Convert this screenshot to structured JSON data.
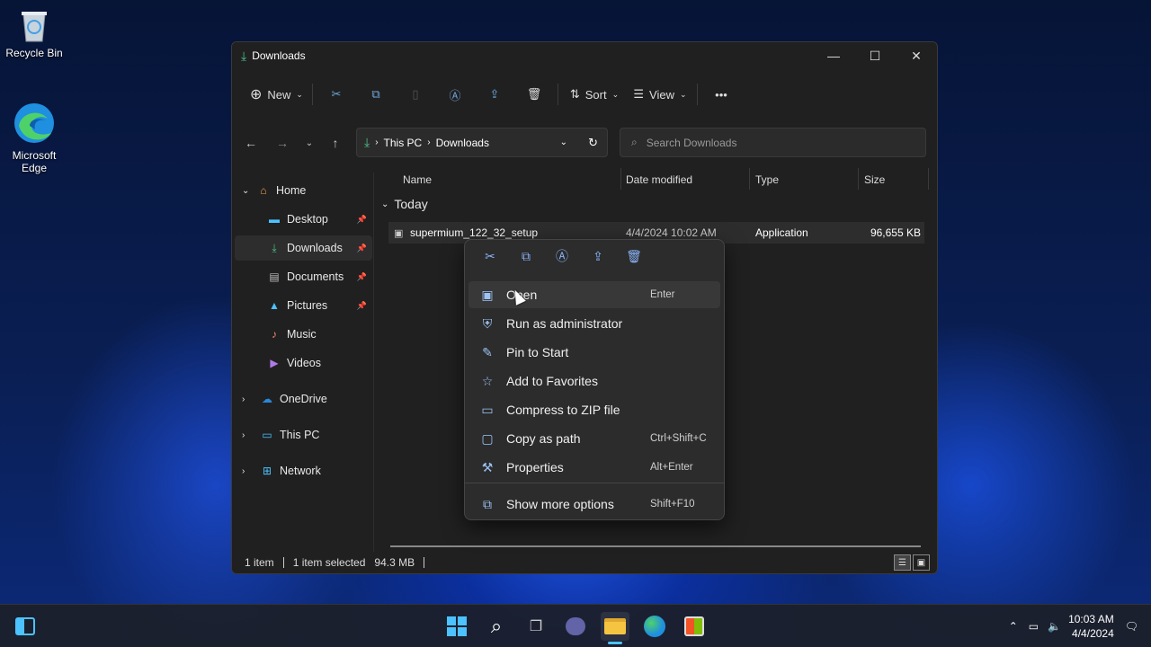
{
  "desktop": {
    "icons": [
      {
        "label": "Recycle Bin",
        "icon": "recycle-bin-icon"
      },
      {
        "label": "Microsoft Edge",
        "icon": "edge-icon"
      }
    ]
  },
  "window": {
    "title": "Downloads",
    "controls": {
      "minimize": "—",
      "maximize": "☐",
      "close": "✕"
    }
  },
  "commandbar": {
    "new_label": "New",
    "sort_label": "Sort",
    "view_label": "View",
    "more_label": "•••"
  },
  "addressbar": {
    "breadcrumb": [
      "This PC",
      "Downloads"
    ],
    "search_placeholder": "Search Downloads"
  },
  "sidebar": {
    "items": [
      {
        "label": "Home",
        "icon": "home-icon"
      },
      {
        "label": "Desktop",
        "icon": "desktop-icon",
        "pinned": true
      },
      {
        "label": "Downloads",
        "icon": "download-icon",
        "pinned": true,
        "selected": true
      },
      {
        "label": "Documents",
        "icon": "documents-icon",
        "pinned": true
      },
      {
        "label": "Pictures",
        "icon": "pictures-icon",
        "pinned": true
      },
      {
        "label": "Music",
        "icon": "music-icon"
      },
      {
        "label": "Videos",
        "icon": "videos-icon"
      },
      {
        "label": "OneDrive",
        "icon": "cloud-icon"
      },
      {
        "label": "This PC",
        "icon": "pc-icon"
      },
      {
        "label": "Network",
        "icon": "network-icon"
      }
    ]
  },
  "filelist": {
    "columns": [
      "Name",
      "Date modified",
      "Type",
      "Size"
    ],
    "group": "Today",
    "rows": [
      {
        "name": "supermium_122_32_setup",
        "date": "4/4/2024 10:02 AM",
        "type": "Application",
        "size": "96,655 KB"
      }
    ]
  },
  "contextmenu": {
    "items": [
      {
        "label": "Open",
        "shortcut": "Enter",
        "icon": "open-icon"
      },
      {
        "label": "Run as administrator",
        "shortcut": "",
        "icon": "shield-icon"
      },
      {
        "label": "Pin to Start",
        "shortcut": "",
        "icon": "pin-icon"
      },
      {
        "label": "Add to Favorites",
        "shortcut": "",
        "icon": "star-icon"
      },
      {
        "label": "Compress to ZIP file",
        "shortcut": "",
        "icon": "zip-icon"
      },
      {
        "label": "Copy as path",
        "shortcut": "Ctrl+Shift+C",
        "icon": "path-icon"
      },
      {
        "label": "Properties",
        "shortcut": "Alt+Enter",
        "icon": "wrench-icon"
      },
      {
        "label": "Show more options",
        "shortcut": "Shift+F10",
        "icon": "more-options-icon"
      }
    ]
  },
  "statusbar": {
    "count": "1 item",
    "selected": "1 item selected",
    "size": "94.3 MB"
  },
  "taskbar": {
    "time": "10:03 AM",
    "date": "4/4/2024"
  },
  "colors": {
    "accent": "#4cc2ff",
    "window_bg": "#202020",
    "menu_bg": "#2c2c2c"
  }
}
